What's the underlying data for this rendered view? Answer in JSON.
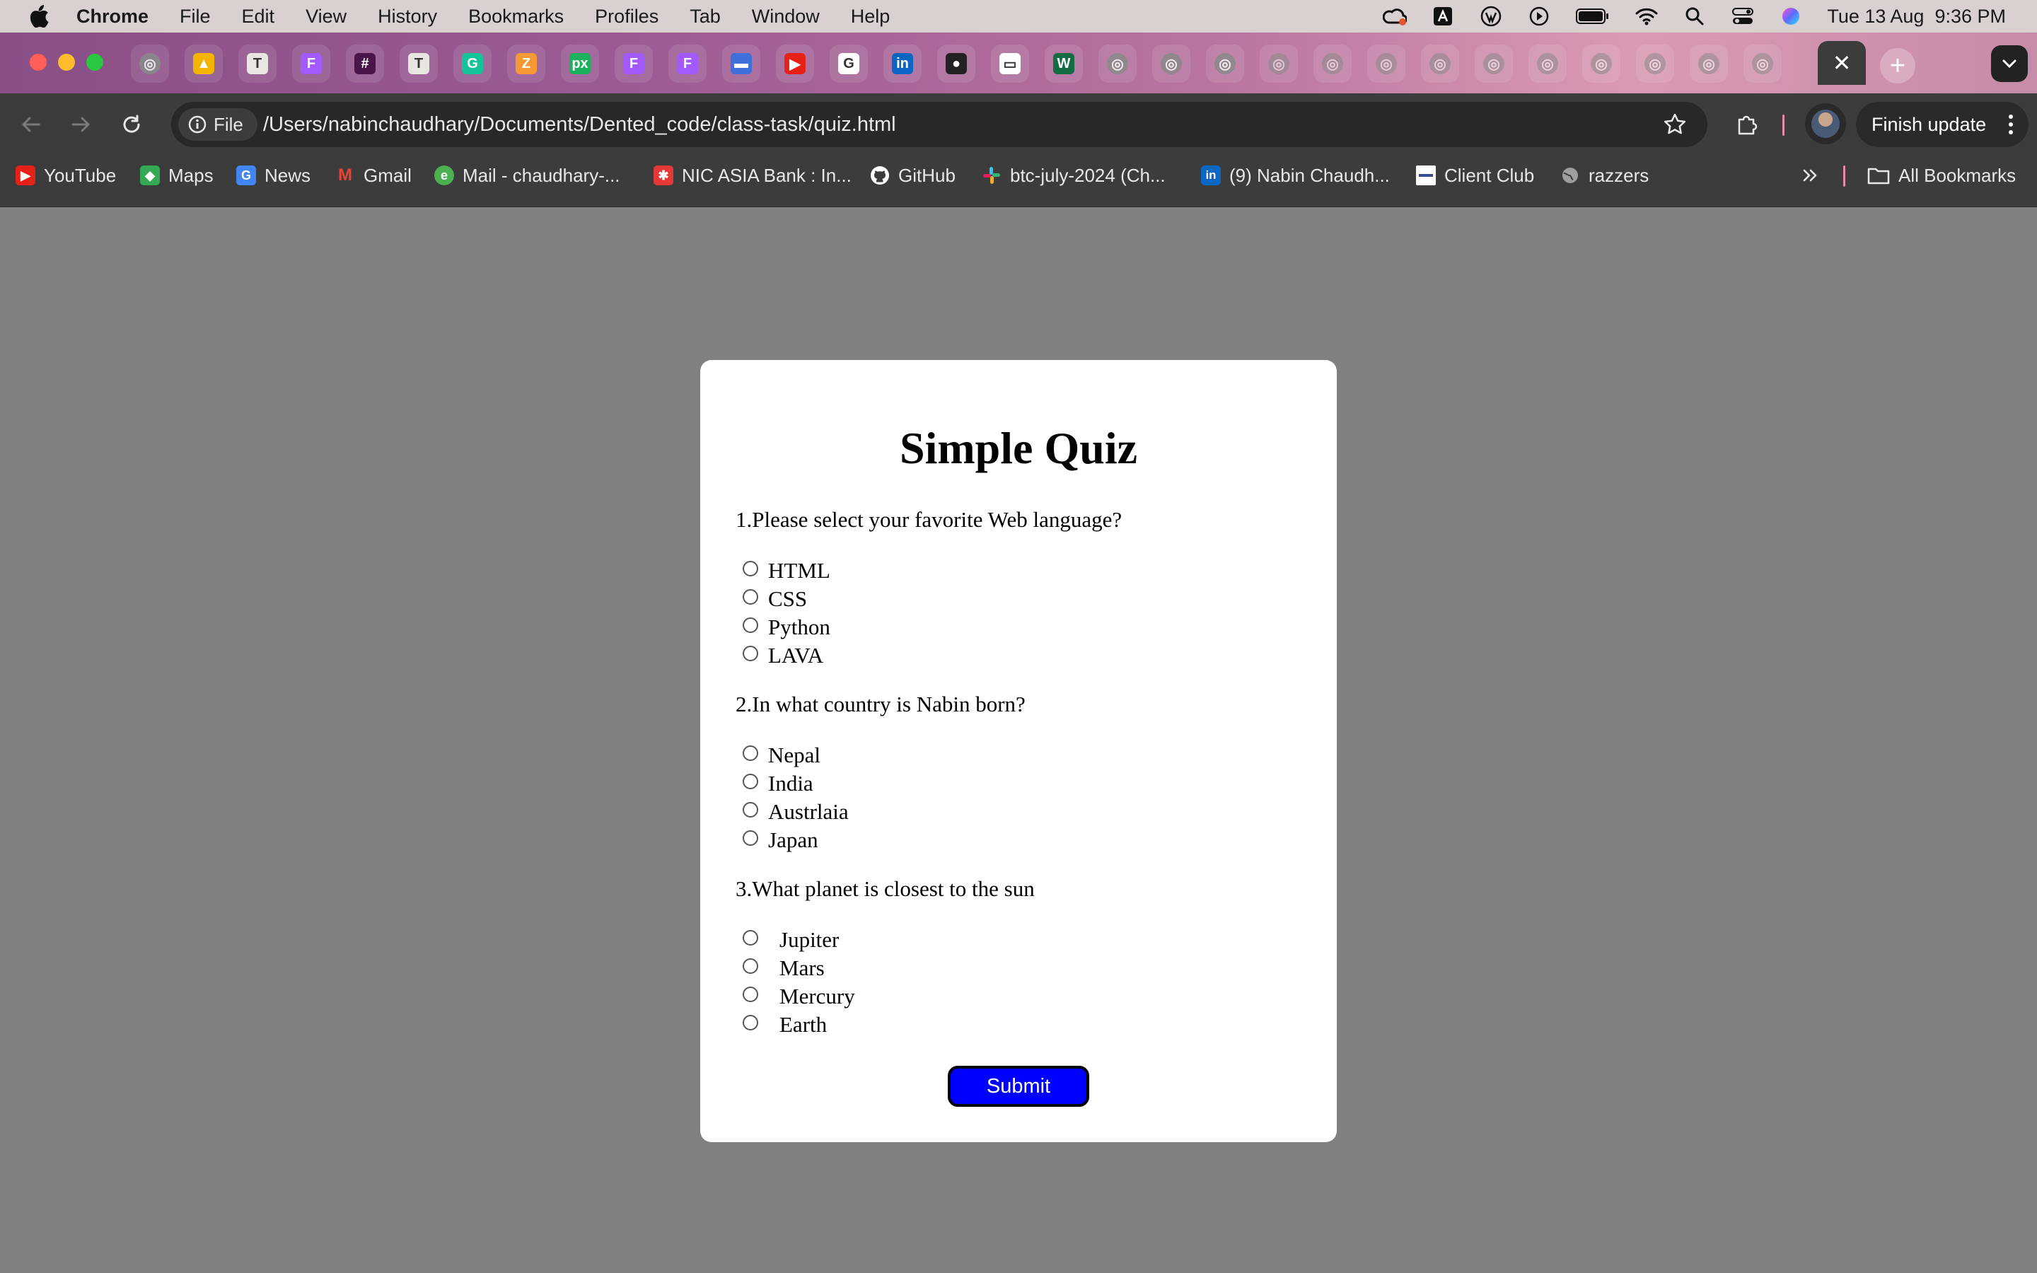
{
  "menubar": {
    "app": "Chrome",
    "items": [
      "File",
      "Edit",
      "View",
      "History",
      "Bookmarks",
      "Profiles",
      "Tab",
      "Window",
      "Help"
    ],
    "clock": "Tue 13 Aug  9:36 PM"
  },
  "tabs": {
    "icons": [
      "globe-icon",
      "google-drive-icon",
      "trello-icon",
      "figma-icon",
      "slack-icon",
      "trello-icon",
      "grammarly-icon",
      "zeplin-icon",
      "pixel-icon",
      "figma-icon",
      "figma-icon",
      "calendar-icon",
      "youtube-icon",
      "google-icon",
      "linkedin-icon",
      "github-icon",
      "club-icon",
      "webflow-icon",
      "globe-icon",
      "globe-icon",
      "globe-icon",
      "globe-icon",
      "globe-icon",
      "globe-icon",
      "globe-icon",
      "globe-icon",
      "globe-icon",
      "globe-icon",
      "globe-icon",
      "globe-icon",
      "globe-icon"
    ],
    "active_close": "✕",
    "new_tab": "+"
  },
  "toolbar": {
    "chip_label": "File",
    "url": "/Users/nabinchaudhary/Documents/Dented_code/class-task/quiz.html",
    "finish_update": "Finish update"
  },
  "bookmarks": {
    "items": [
      {
        "label": "YouTube",
        "icon": "youtube-icon",
        "color": "#e62117"
      },
      {
        "label": "Maps",
        "icon": "maps-icon",
        "color": "#34a853"
      },
      {
        "label": "News",
        "icon": "news-icon",
        "color": "#4285f4"
      },
      {
        "label": "Gmail",
        "icon": "gmail-icon",
        "color": "#ea4335"
      },
      {
        "label": "Mail - chaudhary-...",
        "icon": "mail-icon",
        "color": "#4caf50"
      },
      {
        "label": "NIC ASIA Bank : In...",
        "icon": "bank-icon",
        "color": "#e53935"
      },
      {
        "label": "GitHub",
        "icon": "github-icon",
        "color": "#ffffff"
      },
      {
        "label": "btc-july-2024 (Ch...",
        "icon": "slack-icon",
        "color": "#e01e5a"
      },
      {
        "label": "(9) Nabin Chaudh...",
        "icon": "linkedin-icon",
        "color": "#0a66c2"
      },
      {
        "label": "Client Club",
        "icon": "club-icon",
        "color": "#ffffff"
      },
      {
        "label": "razzers",
        "icon": "globe-icon",
        "color": "#9e9e9e"
      }
    ],
    "all_bookmarks": "All Bookmarks"
  },
  "quiz": {
    "title": "Simple Quiz",
    "questions": [
      {
        "text": "1.Please select your favorite Web language?",
        "options": [
          "HTML",
          "CSS",
          "Python",
          "LAVA"
        ]
      },
      {
        "text": "2.In what country is Nabin born?",
        "options": [
          "Nepal",
          "India",
          "Austrlaia",
          "Japan"
        ]
      },
      {
        "text": "3.What planet is closest to the sun",
        "options": [
          "Jupiter",
          "Mars",
          "Mercury",
          "Earth"
        ]
      }
    ],
    "submit": "Submit"
  },
  "colors": {
    "page_bg": "#808080",
    "submit_bg": "#0000ff"
  }
}
